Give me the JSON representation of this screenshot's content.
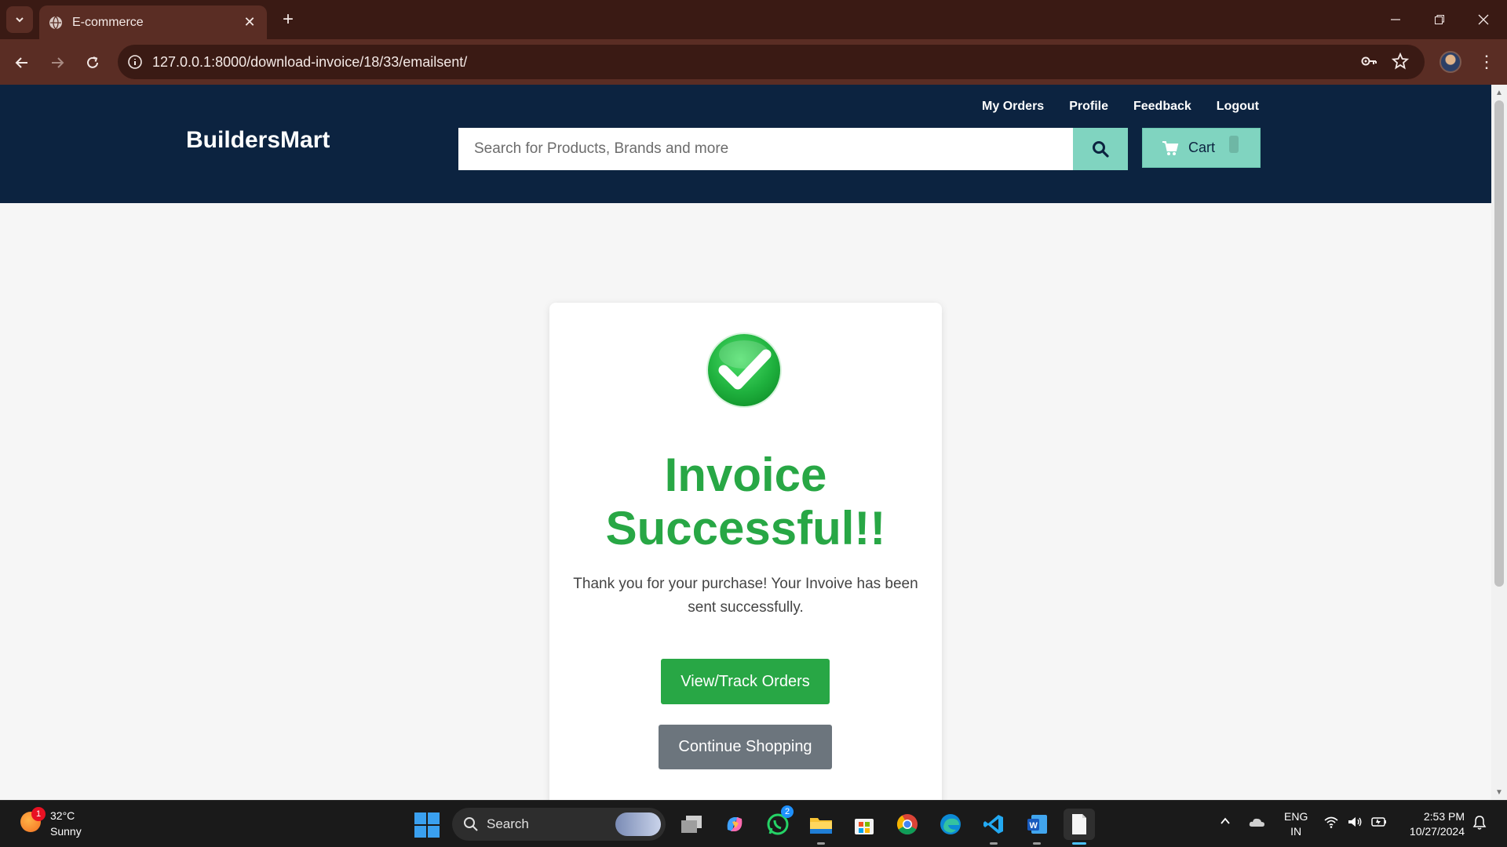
{
  "browser": {
    "tab_title": "E-commerce",
    "url": "127.0.0.1:8000/download-invoice/18/33/emailsent/"
  },
  "header": {
    "brand": "BuildersMart",
    "links": [
      "My Orders",
      "Profile",
      "Feedback",
      "Logout"
    ],
    "search_placeholder": "Search for Products, Brands and more",
    "cart_label": "Cart"
  },
  "card": {
    "title": "Invoice Successful!!",
    "message": "Thank you for your purchase! Your Invoive has been sent successfully.",
    "primary_button": "View/Track Orders",
    "secondary_button": "Continue Shopping"
  },
  "taskbar": {
    "weather_badge": "1",
    "temperature": "32°C",
    "condition": "Sunny",
    "search_label": "Search",
    "whatsapp_badge": "2",
    "language": "ENG",
    "region": "IN",
    "time": "2:53 PM",
    "date": "10/27/2024"
  },
  "colors": {
    "header_bg": "#0c2340",
    "accent": "#80d4c0",
    "success": "#28a745",
    "secondary": "#6c757d",
    "chrome_frame": "#3a1a14"
  }
}
